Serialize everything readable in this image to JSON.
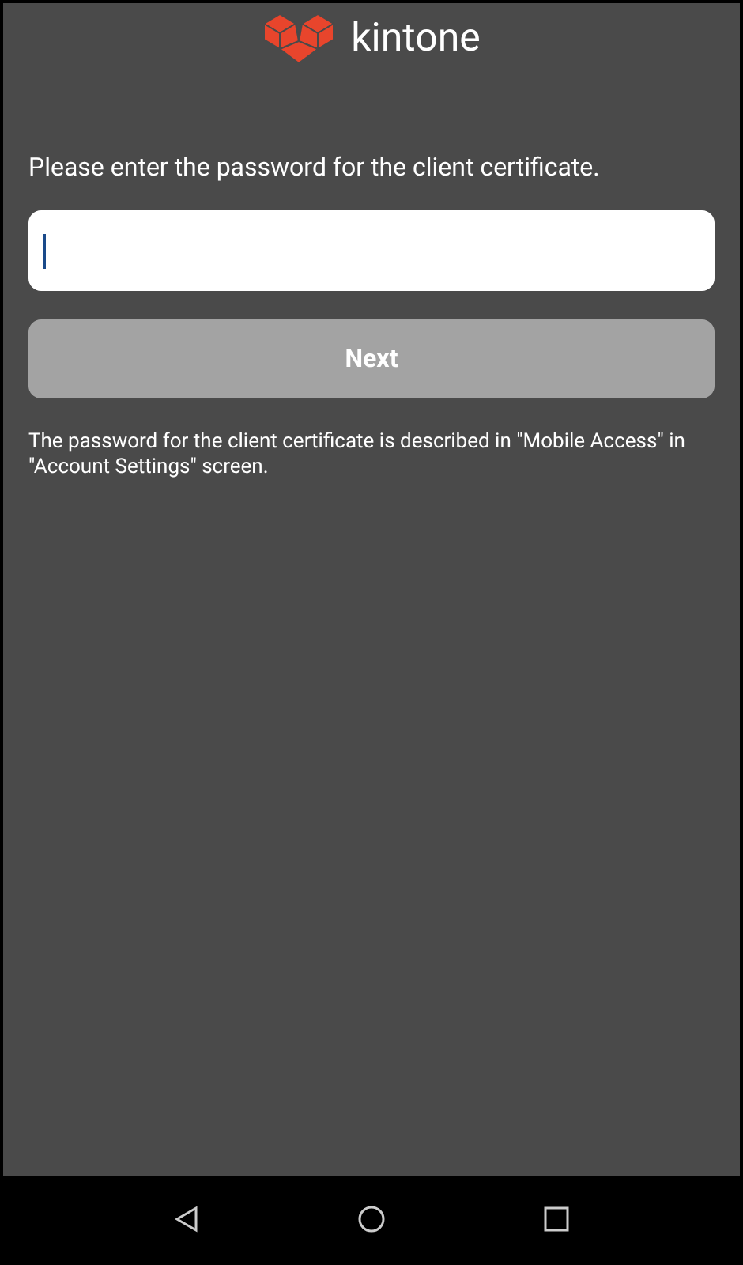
{
  "header": {
    "brand": "kintone"
  },
  "prompt": "Please enter the password for the client certificate.",
  "next_button": {
    "label": "Next",
    "disabled": true
  },
  "help_text": "The password for the client certificate is described in \"Mobile Access\" in \"Account Settings\" screen."
}
